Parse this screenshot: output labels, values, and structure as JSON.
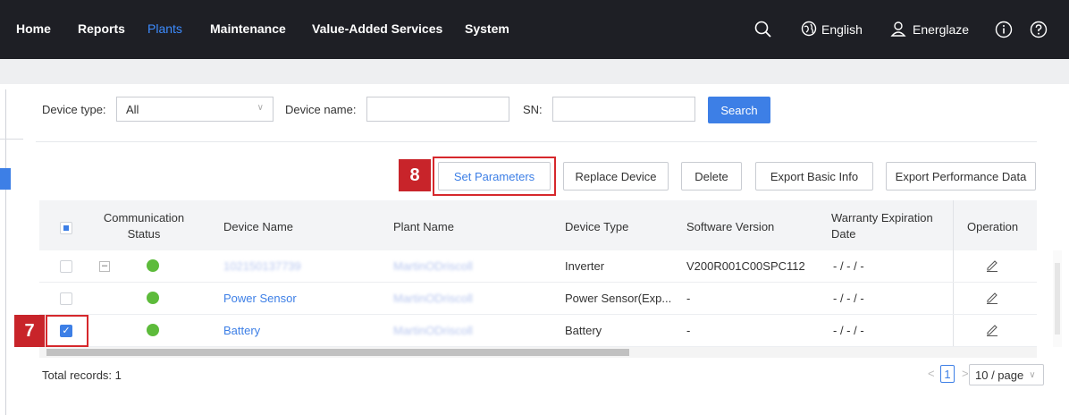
{
  "nav": {
    "items": [
      {
        "label": "Home",
        "active": false
      },
      {
        "label": "Reports",
        "active": false
      },
      {
        "label": "Plants",
        "active": true
      },
      {
        "label": "Maintenance",
        "active": false
      },
      {
        "label": "Value-Added Services",
        "active": false
      },
      {
        "label": "System",
        "active": false
      }
    ],
    "language": "English",
    "user": "Energlaze",
    "icons": [
      "search-icon",
      "globe-icon",
      "user-icon",
      "info-icon",
      "help-icon"
    ]
  },
  "filters": {
    "device_type_label": "Device type:",
    "device_type_value": "All",
    "device_name_label": "Device name:",
    "device_name_value": "",
    "sn_label": "SN:",
    "sn_value": "",
    "search_label": "Search"
  },
  "toolbar": {
    "set_parameters": "Set Parameters",
    "replace_device": "Replace Device",
    "delete": "Delete",
    "export_basic": "Export Basic Info",
    "export_performance": "Export Performance Data"
  },
  "callouts": {
    "step7": "7",
    "step8": "8"
  },
  "table": {
    "columns": {
      "comm_status_1": "Communication",
      "comm_status_2": "Status",
      "device_name": "Device Name",
      "plant_name": "Plant Name",
      "device_type": "Device Type",
      "software_version": "Software Version",
      "warranty_1": "Warranty Expiration",
      "warranty_2": "Date",
      "operation": "Operation"
    },
    "rows": [
      {
        "device_name": "102150137739",
        "plant_name": "MartinODriscoll",
        "device_type": "Inverter",
        "software_version": "V200R001C00SPC112",
        "warranty": "- / - / -",
        "checked": false,
        "status": "online"
      },
      {
        "device_name": "Power Sensor",
        "plant_name": "MartinODriscoll",
        "device_type": "Power Sensor(Exp...",
        "software_version": "-",
        "warranty": "- / - / -",
        "checked": false,
        "status": "online"
      },
      {
        "device_name": "Battery",
        "plant_name": "MartinODriscoll",
        "device_type": "Battery",
        "software_version": "-",
        "warranty": "- / - / -",
        "checked": true,
        "status": "online"
      }
    ]
  },
  "footer": {
    "total_records": "Total records: 1",
    "current_page": "1",
    "page_size": "10 / page"
  },
  "colors": {
    "accent": "#3d7fe6",
    "navbar": "#1e1f25",
    "online": "#5dbb3b",
    "callout": "#c8242a"
  }
}
